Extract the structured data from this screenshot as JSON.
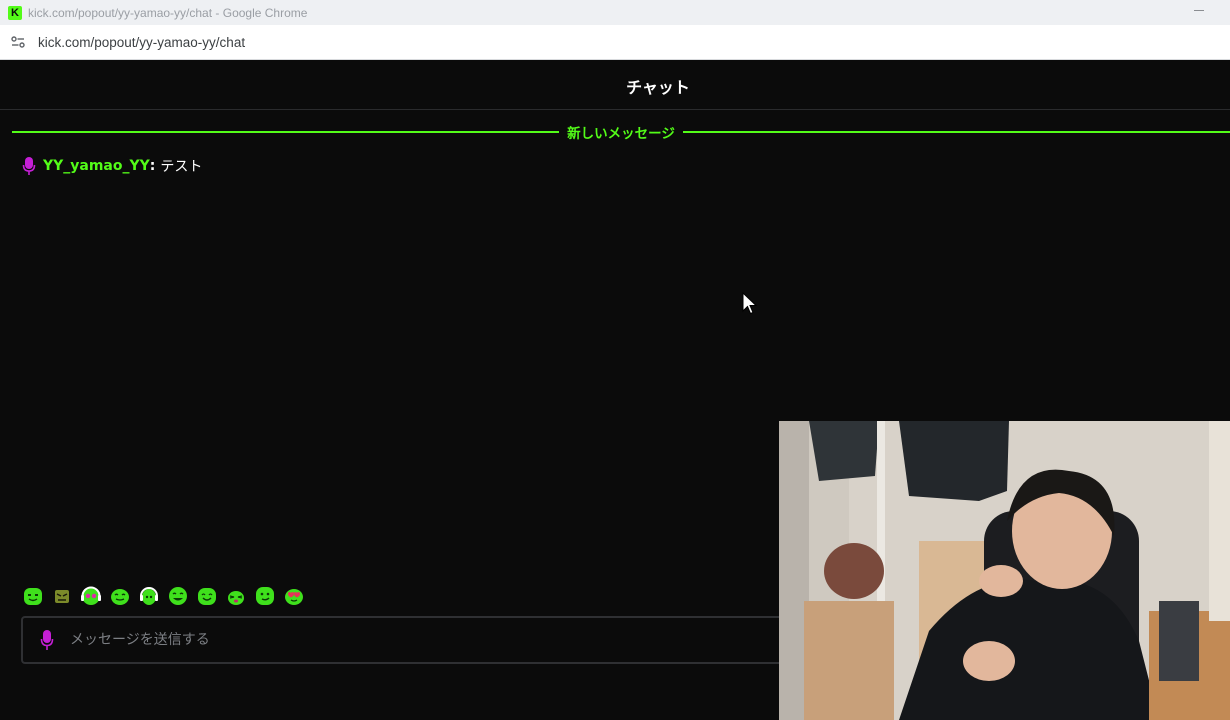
{
  "browser": {
    "window_title": "kick.com/popout/yy-yamao-yy/chat - Google Chrome",
    "url": "kick.com/popout/yy-yamao-yy/chat",
    "favicon_letter": "K"
  },
  "chat": {
    "title": "チャット",
    "new_messages_label": "新しいメッセージ",
    "messages": [
      {
        "username": "YY_yamao_YY",
        "separator": ":",
        "text": "テスト",
        "username_color": "#53fc18"
      }
    ],
    "input_placeholder": "メッセージを送信する"
  },
  "emotes": [
    "emote-grin",
    "emote-angry",
    "emote-headphones",
    "emote-smile",
    "emote-headphones-2",
    "emote-happy",
    "emote-joy",
    "emote-squint",
    "emote-smirk",
    "emote-love"
  ],
  "colors": {
    "accent": "#53fc18",
    "mic_badge": "#c51fd6",
    "background": "#0b0b0b"
  },
  "overlay": {
    "type": "webcam-video"
  }
}
